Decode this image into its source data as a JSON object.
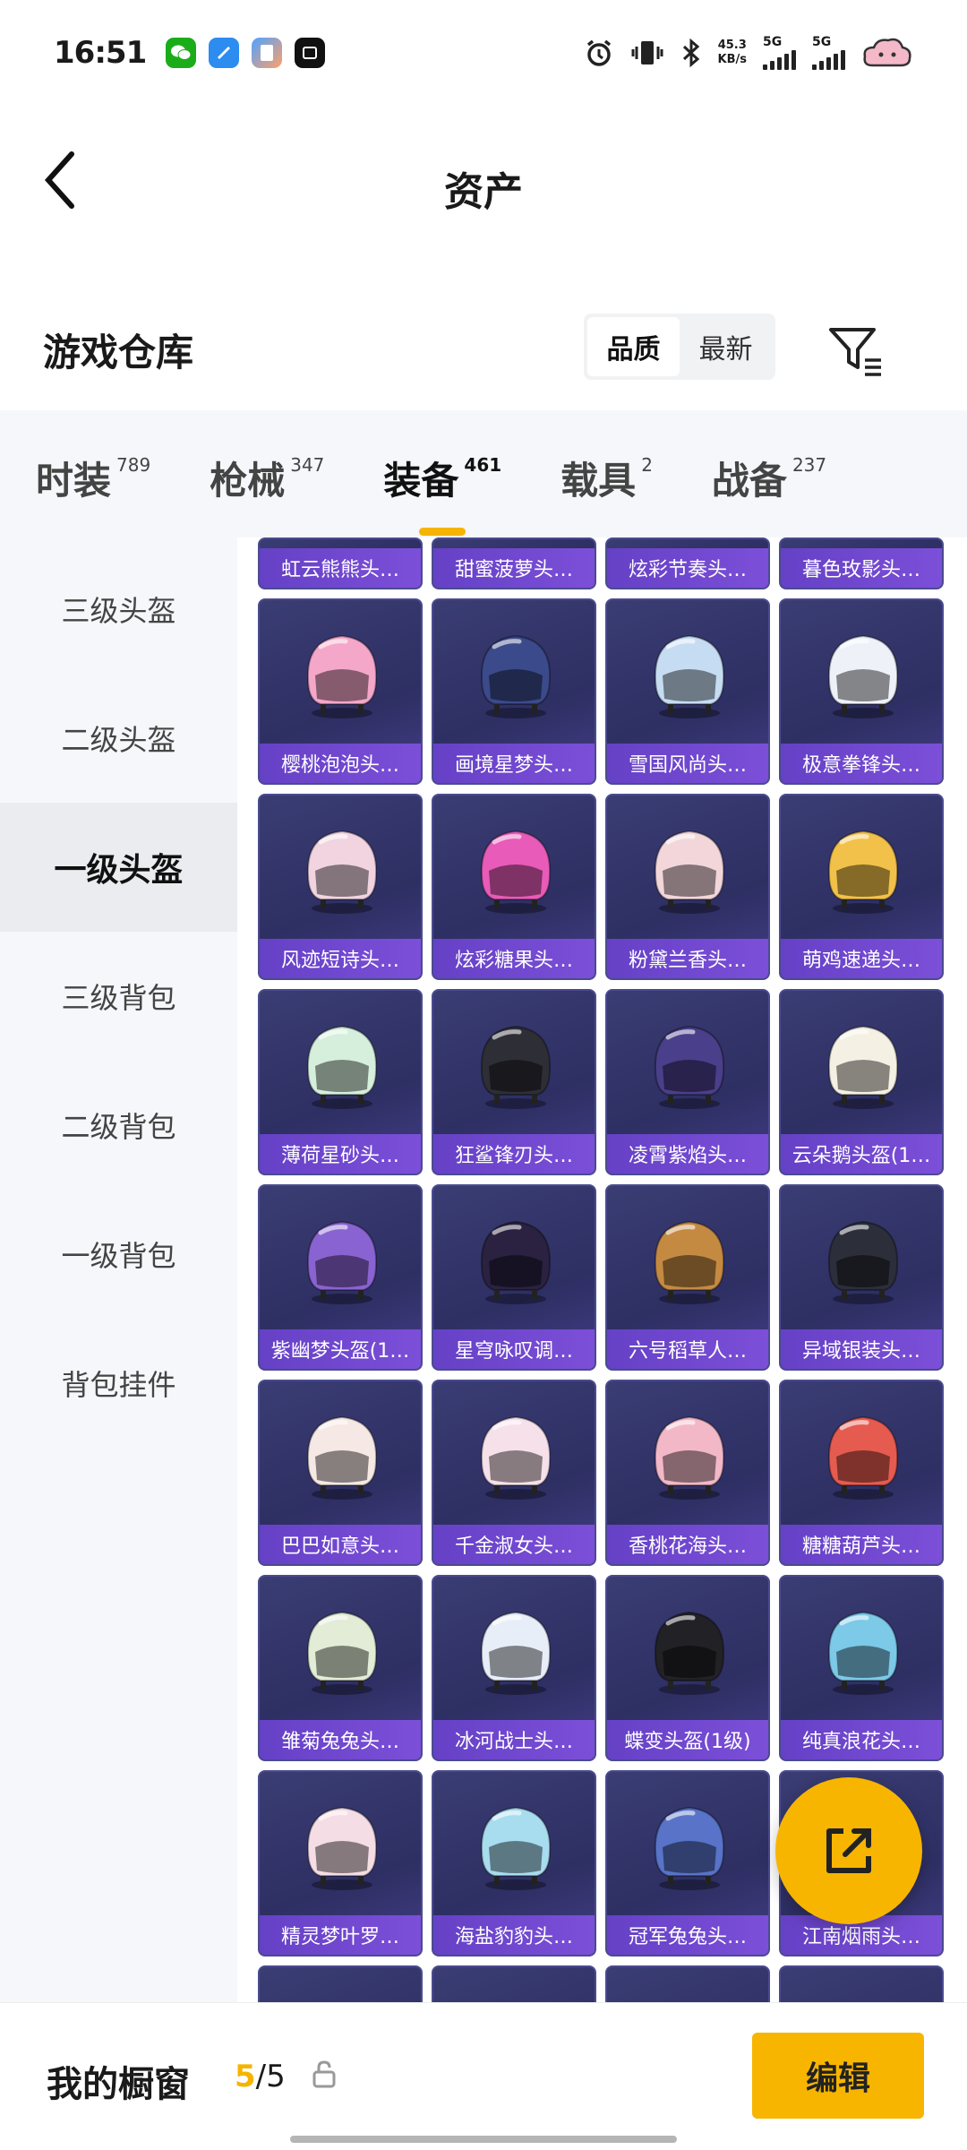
{
  "status_bar": {
    "time": "16:51",
    "net_speed_value": "45.3",
    "net_speed_unit": "KB/s",
    "sig1_label": "5G",
    "sig2_label": "5G"
  },
  "header": {
    "title": "资产"
  },
  "warehouse": {
    "title": "游戏仓库",
    "sort_options": [
      "品质",
      "最新"
    ]
  },
  "tabs": [
    {
      "label": "时装",
      "count": "789"
    },
    {
      "label": "枪械",
      "count": "347"
    },
    {
      "label": "装备",
      "count": "461"
    },
    {
      "label": "载具",
      "count": "2"
    },
    {
      "label": "战备",
      "count": "237"
    }
  ],
  "sidebar": {
    "items": [
      "三级头盔",
      "二级头盔",
      "一级头盔",
      "三级背包",
      "二级背包",
      "一级背包",
      "背包挂件"
    ],
    "active_index": 2
  },
  "items_partial": [
    "虹云熊熊头…",
    "甜蜜菠萝头…",
    "炫彩节奏头…",
    "暮色玫影头…"
  ],
  "items": [
    {
      "name": "樱桃泡泡头…",
      "color": "#f4a7c9"
    },
    {
      "name": "画境星梦头…",
      "color": "#3b4a8a"
    },
    {
      "name": "雪国风尚头…",
      "color": "#c6dcf2"
    },
    {
      "name": "极意拳锋头…",
      "color": "#eef2f8"
    },
    {
      "name": "风迹短诗头…",
      "color": "#f1d4e0"
    },
    {
      "name": "炫彩糖果头…",
      "color": "#e85bb8"
    },
    {
      "name": "粉黛兰香头…",
      "color": "#f2d6da"
    },
    {
      "name": "萌鸡速递头…",
      "color": "#f2c14a"
    },
    {
      "name": "薄荷星砂头…",
      "color": "#d6efdc"
    },
    {
      "name": "狂鲨锋刃头…",
      "color": "#2e2e36"
    },
    {
      "name": "凌霄紫焰头…",
      "color": "#4a3f8a"
    },
    {
      "name": "云朵鹅头盔(1…",
      "color": "#f4f0e4"
    },
    {
      "name": "紫幽梦头盔(1…",
      "color": "#8a63d2"
    },
    {
      "name": "星穹咏叹调…",
      "color": "#2a2240"
    },
    {
      "name": "六号稻草人…",
      "color": "#c58a42"
    },
    {
      "name": "异域银装头…",
      "color": "#2c2f3a"
    },
    {
      "name": "巴巴如意头…",
      "color": "#f6e8e4"
    },
    {
      "name": "千金淑女头…",
      "color": "#f6e1ea"
    },
    {
      "name": "香桃花海头…",
      "color": "#f3b8c8"
    },
    {
      "name": "糖糖葫芦头…",
      "color": "#e65b4f"
    },
    {
      "name": "雏菊兔兔头…",
      "color": "#e2ecd6"
    },
    {
      "name": "冰河战士头…",
      "color": "#e8eef8"
    },
    {
      "name": "蝶变头盔(1级)",
      "color": "#222226"
    },
    {
      "name": "纯真浪花头…",
      "color": "#7cc9e8"
    },
    {
      "name": "精灵梦叶罗…",
      "color": "#f4dde4"
    },
    {
      "name": "海盐豹豹头…",
      "color": "#a8dcef"
    },
    {
      "name": "冠军兔兔头…",
      "color": "#5873c8"
    },
    {
      "name": "江南烟雨头…",
      "color": "#3a3d73"
    }
  ],
  "bottom_bar": {
    "label": "我的橱窗",
    "count_current": "5",
    "count_total": "/5",
    "edit_label": "编辑"
  },
  "colors": {
    "accent": "#f7b500",
    "card_label": "#6d47cf"
  }
}
